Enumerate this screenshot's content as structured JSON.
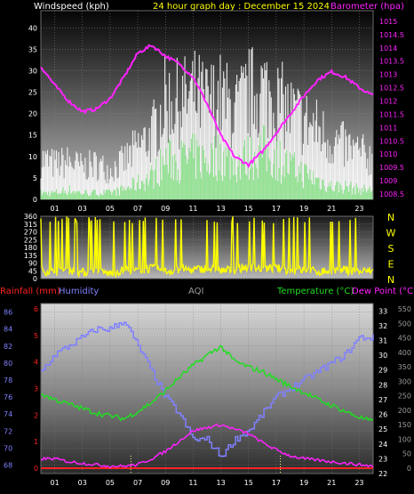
{
  "header": {
    "title": "24 hour graph day : December 15 2024",
    "left_label": "Windspeed (kph)",
    "right_label": "Barometer (hpa)"
  },
  "colors": {
    "wind_gust": "#ffffff",
    "wind_avg": "#7fe07f",
    "barometer": "#ff22ff",
    "direction": "#ffff00",
    "rain": "#ff2222",
    "humidity": "#8080ff",
    "temperature": "#22dd22",
    "dewpoint": "#ff22ff",
    "title": "#ffff00"
  },
  "compass": [
    "N",
    "W",
    "S",
    "E",
    "N"
  ],
  "bottom_header": {
    "rain_label": "Rainfall (mm)",
    "humidity_label": "Humidity",
    "aqi_label": "AQI",
    "temp_label": "Temperature (°C)",
    "dew_label": "Dew Point (°C)"
  },
  "chart_data": [
    {
      "type": "line",
      "title": "24 hour graph day : December 15 2024",
      "x_ticks": [
        "01",
        "03",
        "05",
        "07",
        "09",
        "11",
        "13",
        "15",
        "17",
        "19",
        "21",
        "23"
      ],
      "y_left_ticks": [
        "0",
        "5",
        "10",
        "15",
        "20",
        "25",
        "30",
        "35",
        "40"
      ],
      "y_right_ticks": [
        "1008.5",
        "1009",
        "1009.5",
        "1010",
        "1010.5",
        "1011",
        "1011.5",
        "1012",
        "1012.5",
        "1013",
        "1013.5",
        "1014",
        "1014.5",
        "1015"
      ],
      "ylim_left": [
        0,
        44
      ],
      "ylim_right": [
        1008.3,
        1015.4
      ],
      "series": [
        {
          "name": "Windspeed (kph)",
          "x": [
            0,
            1,
            2,
            3,
            4,
            5,
            6,
            7,
            8,
            9,
            10,
            11,
            12,
            13,
            14,
            15,
            16,
            17,
            18,
            19,
            20,
            21,
            22,
            23,
            24
          ],
          "gust": [
            14,
            12,
            13,
            11,
            12,
            10,
            13,
            18,
            22,
            34,
            33,
            36,
            33,
            35,
            30,
            36,
            38,
            34,
            30,
            27,
            24,
            20,
            18,
            16,
            14
          ],
          "avg": [
            2,
            2,
            3,
            2,
            2,
            2,
            3,
            5,
            7,
            12,
            12,
            13,
            12,
            14,
            11,
            13,
            15,
            13,
            10,
            8,
            6,
            4,
            4,
            3,
            3
          ]
        },
        {
          "name": "Barometer (hpa)",
          "x": [
            0,
            1,
            2,
            3,
            4,
            5,
            6,
            7,
            8,
            9,
            10,
            11,
            12,
            13,
            14,
            15,
            16,
            17,
            18,
            19,
            20,
            21,
            22,
            23,
            24
          ],
          "values": [
            1013.3,
            1012.6,
            1012.0,
            1011.6,
            1011.7,
            1012.1,
            1012.9,
            1013.8,
            1014.1,
            1013.7,
            1013.4,
            1012.9,
            1011.9,
            1010.7,
            1009.9,
            1009.6,
            1010.1,
            1010.8,
            1011.5,
            1012.2,
            1012.8,
            1013.1,
            1012.9,
            1012.5,
            1012.2
          ]
        }
      ]
    },
    {
      "type": "line",
      "y_ticks": [
        "0",
        "45",
        "90",
        "135",
        "180",
        "225",
        "270",
        "315",
        "360"
      ],
      "ylim": [
        0,
        360
      ],
      "series": [
        {
          "name": "Wind direction",
          "x": [
            0,
            1,
            2,
            3,
            4,
            5,
            6,
            7,
            8,
            9,
            10,
            11,
            12,
            13,
            14,
            15,
            16,
            17,
            18,
            19,
            20,
            21,
            22,
            23,
            24
          ],
          "values": [
            45,
            40,
            50,
            35,
            40,
            30,
            50,
            45,
            60,
            40,
            55,
            50,
            60,
            45,
            50,
            70,
            55,
            60,
            45,
            50,
            40,
            45,
            50,
            40,
            45
          ]
        }
      ]
    },
    {
      "type": "line",
      "x_ticks": [
        "01",
        "03",
        "05",
        "07",
        "09",
        "11",
        "13",
        "15",
        "17",
        "19",
        "21",
        "23"
      ],
      "y_left_ticks": [
        "68",
        "70",
        "72",
        "74",
        "76",
        "78",
        "80",
        "82",
        "84",
        "86"
      ],
      "y_rain_ticks": [
        "0",
        "1",
        "2",
        "3",
        "4",
        "5",
        "6"
      ],
      "y_temp_ticks": [
        "22",
        "23",
        "24",
        "25",
        "26",
        "27",
        "28",
        "29",
        "30",
        "31",
        "32",
        "33"
      ],
      "y_aqi_ticks": [
        "0",
        "50",
        "100",
        "150",
        "200",
        "250",
        "300",
        "350",
        "400",
        "450",
        "500",
        "550"
      ],
      "ylim_humidity": [
        67,
        87
      ],
      "ylim_temp": [
        22,
        33.5
      ],
      "series": [
        {
          "name": "Humidity",
          "x": [
            0,
            1,
            2,
            3,
            4,
            5,
            6,
            7,
            8,
            9,
            10,
            11,
            12,
            13,
            14,
            15,
            16,
            17,
            18,
            19,
            20,
            21,
            22,
            23,
            24
          ],
          "values": [
            79,
            81,
            82,
            83,
            84,
            84,
            85,
            82,
            79,
            76,
            74,
            71,
            71,
            69,
            71,
            72,
            74,
            76,
            77,
            78,
            79,
            80,
            81,
            83,
            83
          ]
        },
        {
          "name": "Temperature (°C)",
          "x": [
            0,
            1,
            2,
            3,
            4,
            5,
            6,
            7,
            8,
            9,
            10,
            11,
            12,
            13,
            14,
            15,
            16,
            17,
            18,
            19,
            20,
            21,
            22,
            23,
            24
          ],
          "values": [
            27.4,
            27.0,
            26.7,
            26.4,
            26.1,
            25.9,
            25.7,
            26.2,
            26.8,
            27.6,
            28.5,
            29.3,
            30.0,
            30.6,
            29.6,
            29.2,
            28.9,
            28.4,
            27.9,
            27.5,
            27.0,
            26.6,
            26.2,
            25.8,
            25.5
          ]
        },
        {
          "name": "Dew Point (°C)",
          "x": [
            0,
            1,
            2,
            3,
            4,
            5,
            6,
            7,
            8,
            9,
            10,
            11,
            12,
            13,
            14,
            15,
            16,
            17,
            18,
            19,
            20,
            21,
            22,
            23,
            24
          ],
          "values": [
            23.0,
            23.0,
            22.8,
            22.7,
            22.6,
            22.5,
            22.5,
            22.6,
            23.0,
            23.5,
            24.2,
            24.9,
            25.1,
            25.3,
            25.0,
            24.7,
            24.1,
            23.6,
            23.2,
            23.0,
            22.9,
            22.8,
            22.7,
            22.6,
            22.5
          ]
        },
        {
          "name": "Rainfall (mm)",
          "x": [
            0,
            24
          ],
          "values": [
            0,
            0
          ]
        }
      ]
    }
  ]
}
